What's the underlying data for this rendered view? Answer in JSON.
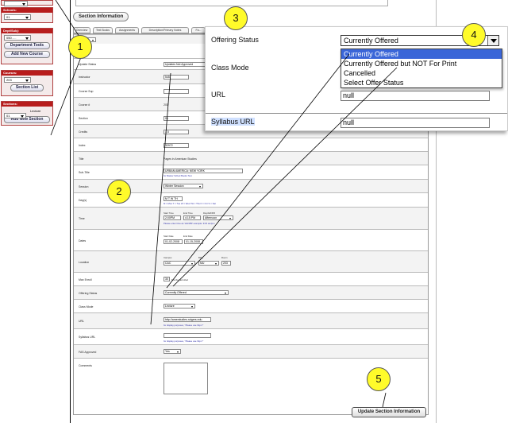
{
  "sidebar": {
    "panels": [
      {
        "header": "",
        "select_value": "",
        "buttons": []
      },
      {
        "header": "Schools:",
        "select_value": "01",
        "buttons": []
      },
      {
        "header": "Dept/Subj:",
        "select_value": "050 - ..",
        "buttons": [
          "Department Tools",
          "Add New Course"
        ]
      },
      {
        "header": "Courses:",
        "select_value": "203",
        "buttons": [
          "Section List"
        ]
      },
      {
        "header": "Sections:",
        "select_value": "01",
        "select_suffix": "Lecture",
        "buttons": [
          "Add New Section"
        ]
      }
    ]
  },
  "main": {
    "section_tab": "Section Information",
    "tabs": [
      "Overview",
      "Text Books",
      "Assignments",
      "Description/Primary Notes",
      "Fa..."
    ],
    "update_button": "Update Section Information",
    "rows": [
      {
        "label": "Update Status",
        "value": "Updates Not Approved"
      },
      {
        "label": "Instructor",
        "value": "545"
      },
      {
        "label": "Course Sup",
        "value": ""
      },
      {
        "label": "Course #",
        "value": "203"
      },
      {
        "label": "Section",
        "value": "01"
      },
      {
        "label": "Credits",
        "value": "1.5"
      },
      {
        "label": "Index",
        "value": "32972"
      },
      {
        "label": "Title",
        "value": "Pages in American Studies"
      },
      {
        "label": "Sub-Title",
        "value": "URBAN AMERICA: NEW YORK",
        "hint": "for Master Sched Books Text"
      },
      {
        "label": "Session",
        "value": "Winter Session"
      },
      {
        "label": "Day(s)",
        "value": "M T W TH",
        "hint": "M = Mon  T = Tue  W = Wed  TH = Thur  F = Fri  S = Sat"
      },
      {
        "label": "Time",
        "mini": [
          "Start Time",
          "End Time",
          "Day/AM/PM"
        ],
        "value": "2:00PM",
        "value2": "4:15 PM",
        "value3": "Afternoon",
        "hint": "Please enter time as 'HH:MM' example: 9:15 am/pm"
      },
      {
        "label": "Dates",
        "mini": [
          "Start Date",
          "End Date"
        ],
        "value": "01-02-2008",
        "value2": "01-15-2008"
      },
      {
        "label": "Location",
        "mini": [
          "Campus",
          "Bldg",
          "Room"
        ],
        "value": "CAC",
        "value2": "MU",
        "value3": "203"
      },
      {
        "label": "Max Enroll",
        "value": "30",
        "value_suffix": "Number Enrolled"
      },
      {
        "label": "Offering Status",
        "value": "Currently Offered"
      },
      {
        "label": "Class Mode",
        "value": "Lecture"
      },
      {
        "label": "URL",
        "value": "http://amerstudies.rutgers.edu",
        "hint": "for display purposes, \"Please use http://\""
      },
      {
        "label": "Syllabus URL",
        "value": "",
        "hint": "for display purposes, \"Please use http://\""
      },
      {
        "label": "FAS Approved",
        "value": "Yes"
      },
      {
        "label": "Comments",
        "value": ""
      }
    ]
  },
  "zoom": {
    "offering_status_label": "Offering Status",
    "offering_status_value": "Currently Offered",
    "options": [
      "Currently Offered",
      "Currently Offered but NOT For Print",
      "Cancelled",
      "Select Offer Status"
    ],
    "selected_option": 0,
    "class_mode_label": "Class Mode",
    "url_label": "URL",
    "url_value": "null",
    "syllabus_label": "Syllabus URL",
    "syllabus_value": "null"
  },
  "callouts": [
    "1",
    "2",
    "3",
    "4",
    "5"
  ],
  "colors": {
    "sidebar_header": "#b81c1c",
    "callout_fill": "#fffb2a",
    "highlight": "#3a66d8",
    "syllabus_label_bg": "#cfe0ff"
  }
}
